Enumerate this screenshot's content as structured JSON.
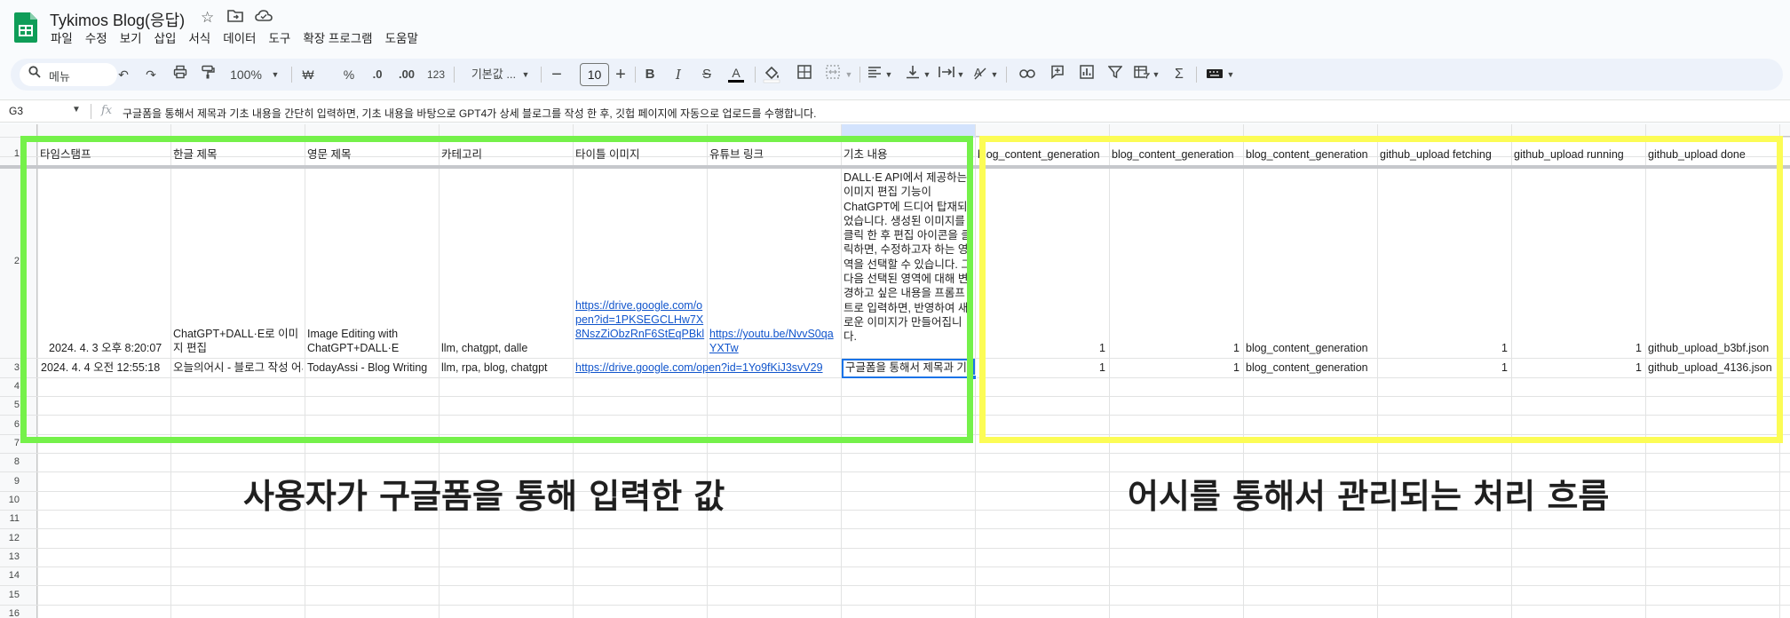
{
  "doc": {
    "title": "Tykimos Blog(응답)"
  },
  "title_icons": [
    "star-icon",
    "move-to-folder-icon",
    "cloud-saved-icon"
  ],
  "menu": [
    "파일",
    "수정",
    "보기",
    "삽입",
    "서식",
    "데이터",
    "도구",
    "확장 프로그램",
    "도움말"
  ],
  "toolbar": {
    "search_placeholder": "메뉴",
    "zoom": "100%",
    "currency": "₩",
    "percent": "%",
    "dec_decrease": ".0",
    "dec_increase": ".00",
    "number_format": "123",
    "font_name": "기본값 ...",
    "font_size": "10"
  },
  "formula_bar": {
    "cell_ref": "G3",
    "fx": "fx",
    "content": "구글폼을 통해서 제목과 기초 내용을 간단히 입력하면, 기초 내용을 바탕으로 GPT4가 상세 블로그를 작성 한 후, 깃헙 페이지에 자동으로 업로드를 수행합니다."
  },
  "row_numbers": [
    "1",
    "2",
    "3",
    "4",
    "5",
    "6",
    "7",
    "8",
    "9",
    "10",
    "11",
    "12",
    "13",
    "14",
    "15",
    "16"
  ],
  "columns": [
    "타임스탬프",
    "한글 제목",
    "영문 제목",
    "카테고리",
    "타이틀 이미지",
    "유튜브 링크",
    "기초 내용",
    "blog_content_generation",
    "blog_content_generation",
    "blog_content_generation",
    "github_upload fetching",
    "github_upload running",
    "github_upload done"
  ],
  "rows": [
    {
      "timestamp": "2024. 4. 3 오후 8:20:07",
      "kr_title": "ChatGPT+DALL·E로 이미지 편집",
      "en_title": "Image Editing with ChatGPT+DALL·E",
      "category": "llm, chatgpt, dalle",
      "title_image": "https://drive.google.com/open?id=1PKSEGCLHw7X8NszZiObzRnF6StEqPBkl",
      "youtube": "https://youtu.be/NvvS0qaYXTw",
      "content": "DALL·E API에서 제공하는 이미지 편집 기능이 ChatGPT에 드디어 탑재되었습니다. 생성된 이미지를 클릭 한 후 편집 아이콘을 클릭하면, 수정하고자 하는 영역을 선택할 수 있습니다. 그 다음 선택된 영역에 대해 변경하고 싶은 내용을 프롬프트로 입력하면, 반영하여 새로운 이미지가 만들어집니다.",
      "gen1": "1",
      "gen2": "1",
      "gen3": "blog_content_generation",
      "fetching": "1",
      "running": "1",
      "done": "github_upload_b3bf.json"
    },
    {
      "timestamp": "2024. 4. 4 오전 12:55:18",
      "kr_title": "오늘의어시 - 블로그 작성 어시",
      "en_title": "TodayAssi - Blog Writing",
      "category": "llm, rpa, blog, chatgpt",
      "title_image": "https://drive.google.com/open?id=1Yo9fKiJ3svV29",
      "youtube": "",
      "content": "구글폼을 통해서 제목과 기초 내용을",
      "gen1": "1",
      "gen2": "1",
      "gen3": "blog_content_generation",
      "fetching": "1",
      "running": "1",
      "done": "github_upload_4136.json"
    }
  ],
  "annotations": {
    "left": "사용자가 구글폼을 통해 입력한 값",
    "right": "어시를 통해서 관리되는 처리 흐름"
  },
  "colors": {
    "green_box": "#75f14a",
    "yellow_box": "#fcfc55",
    "selection": "#1a73e8",
    "link": "#1155cc",
    "sheets_green": "#0f9d58"
  }
}
